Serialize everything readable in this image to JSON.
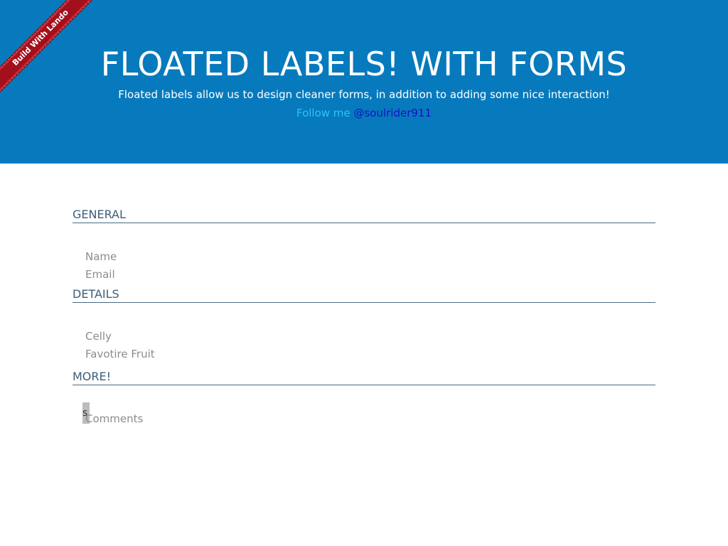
{
  "ribbon": {
    "label": "Build With Lando"
  },
  "header": {
    "title": "FLOATED LABELS! WITH FORMS",
    "subtitle": "Floated labels allow us to design cleaner forms, in addition to adding some nice interaction!",
    "follow_prefix": "Follow me",
    "follow_handle": "@soulrider911"
  },
  "form": {
    "general": {
      "title": "GENERAL",
      "name_label": "Name",
      "email_label": "Email"
    },
    "details": {
      "title": "DETAILS",
      "cell_label": "Celly",
      "fruit_label": "Favotire Fruit"
    },
    "more": {
      "title": "MORE!",
      "comments_label": "Comments",
      "comments_value": "s"
    }
  },
  "colors": {
    "header_bg": "#077abd",
    "ribbon_bg": "#a3101c",
    "follow_text": "#2cc3f5",
    "link": "#1a0dcc",
    "section_title": "#3d5e7a",
    "label_text": "#8c8c8c"
  }
}
